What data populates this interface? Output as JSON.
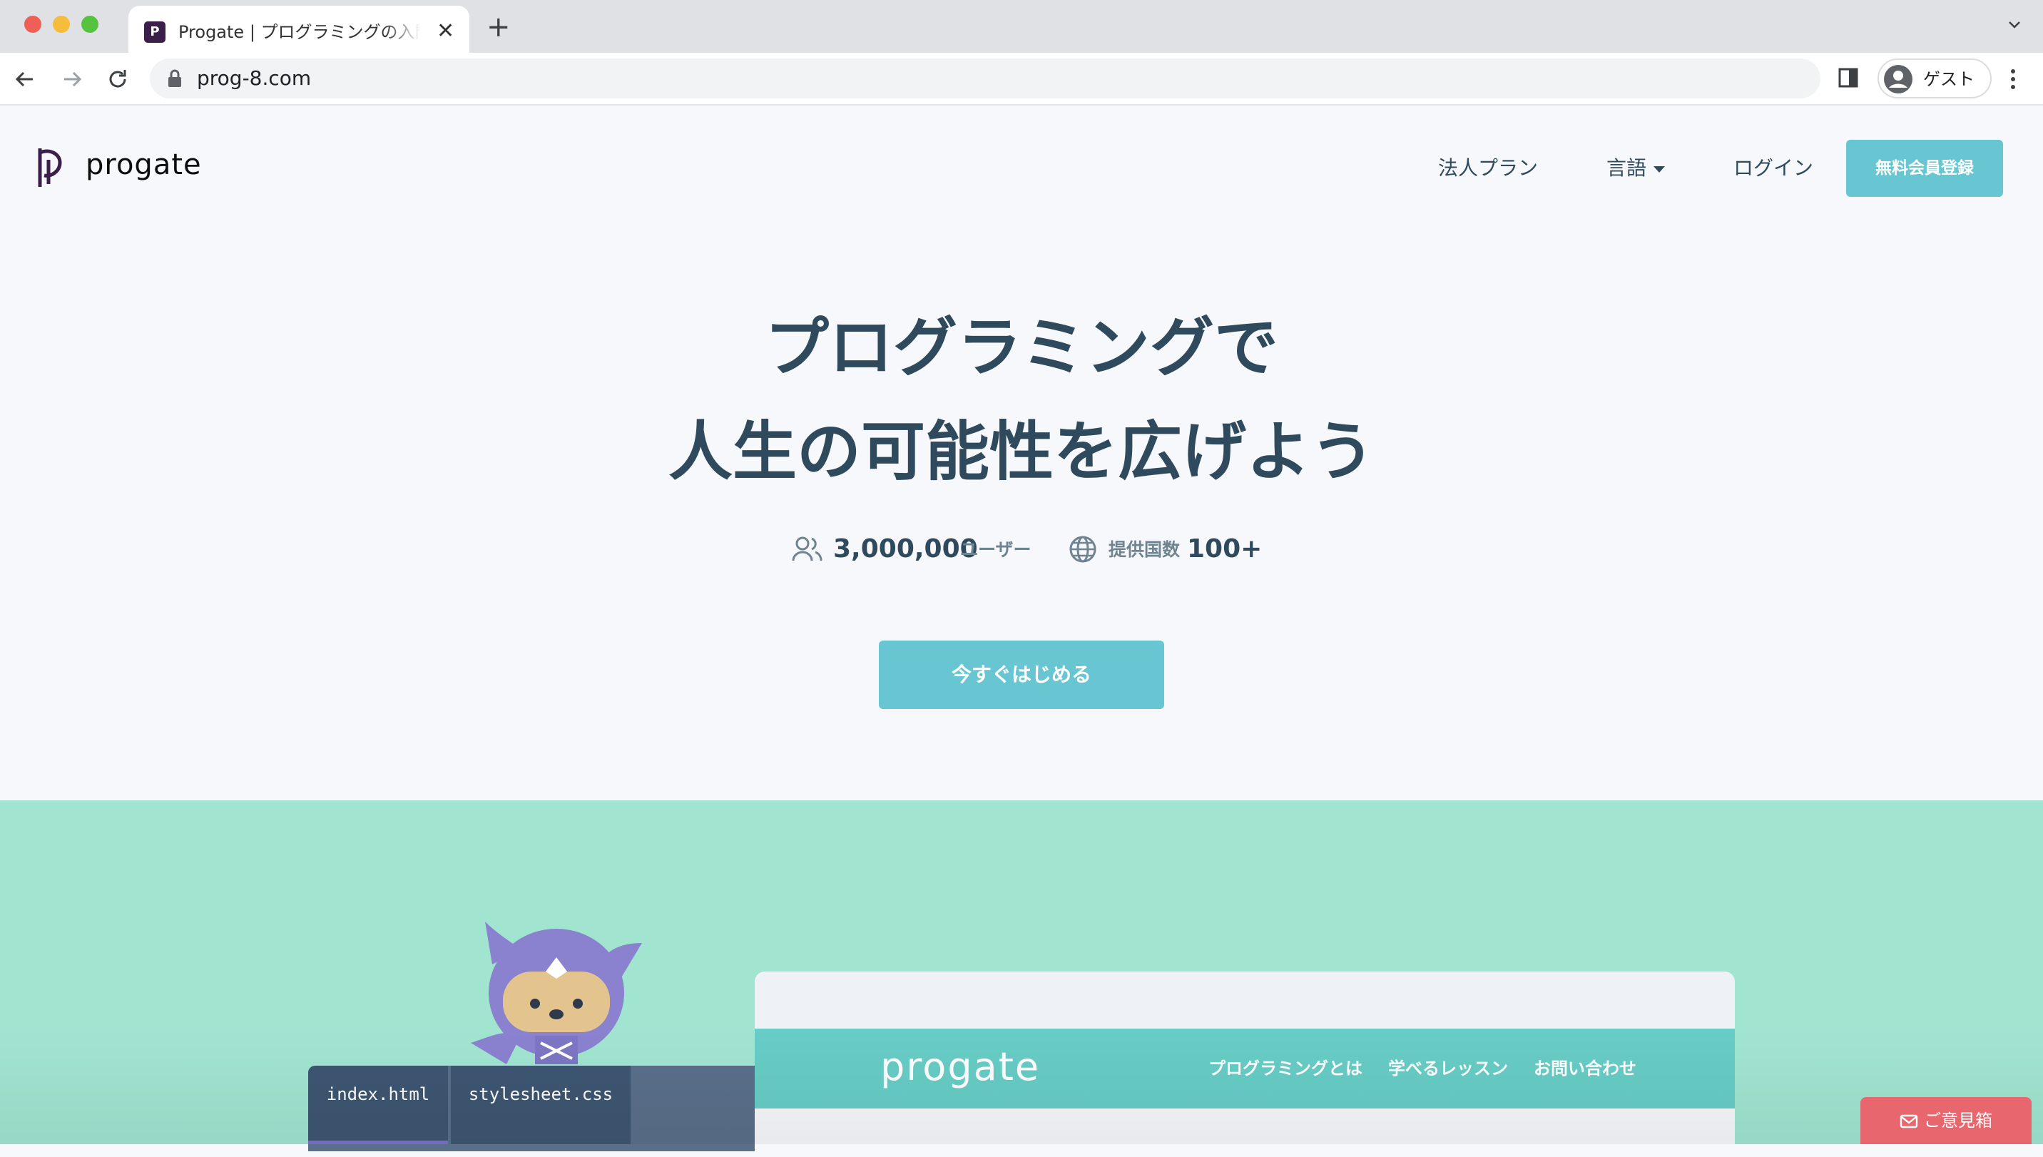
{
  "browser": {
    "tab_title": "Progate | プログラミングの入門なら",
    "url": "prog-8.com",
    "profile_label": "ゲスト"
  },
  "header": {
    "logo_text": "progate",
    "nav": {
      "corporate": "法人プラン",
      "language": "言語",
      "login": "ログイン"
    },
    "signup_label": "無料会員登録"
  },
  "hero": {
    "title_line1": "プログラミングで",
    "title_line2": "人生の可能性を広げよう",
    "users_count": "3,000,000",
    "users_label": "ユーザー",
    "countries_label": "提供国数",
    "countries_count": "100+",
    "cta_label": "今すぐはじめる"
  },
  "demo": {
    "editor_tabs": [
      "index.html",
      "stylesheet.css"
    ],
    "mock_logo": "progate",
    "mock_links": [
      "プログラミングとは",
      "学べるレッスン",
      "お問い合わせ"
    ]
  },
  "feedback_label": "ご意見箱",
  "colors": {
    "brand_teal": "#67c6d1",
    "section_green": "#a1e5d1",
    "heading": "#2f4a5d",
    "feedback_red": "#e8676e"
  }
}
